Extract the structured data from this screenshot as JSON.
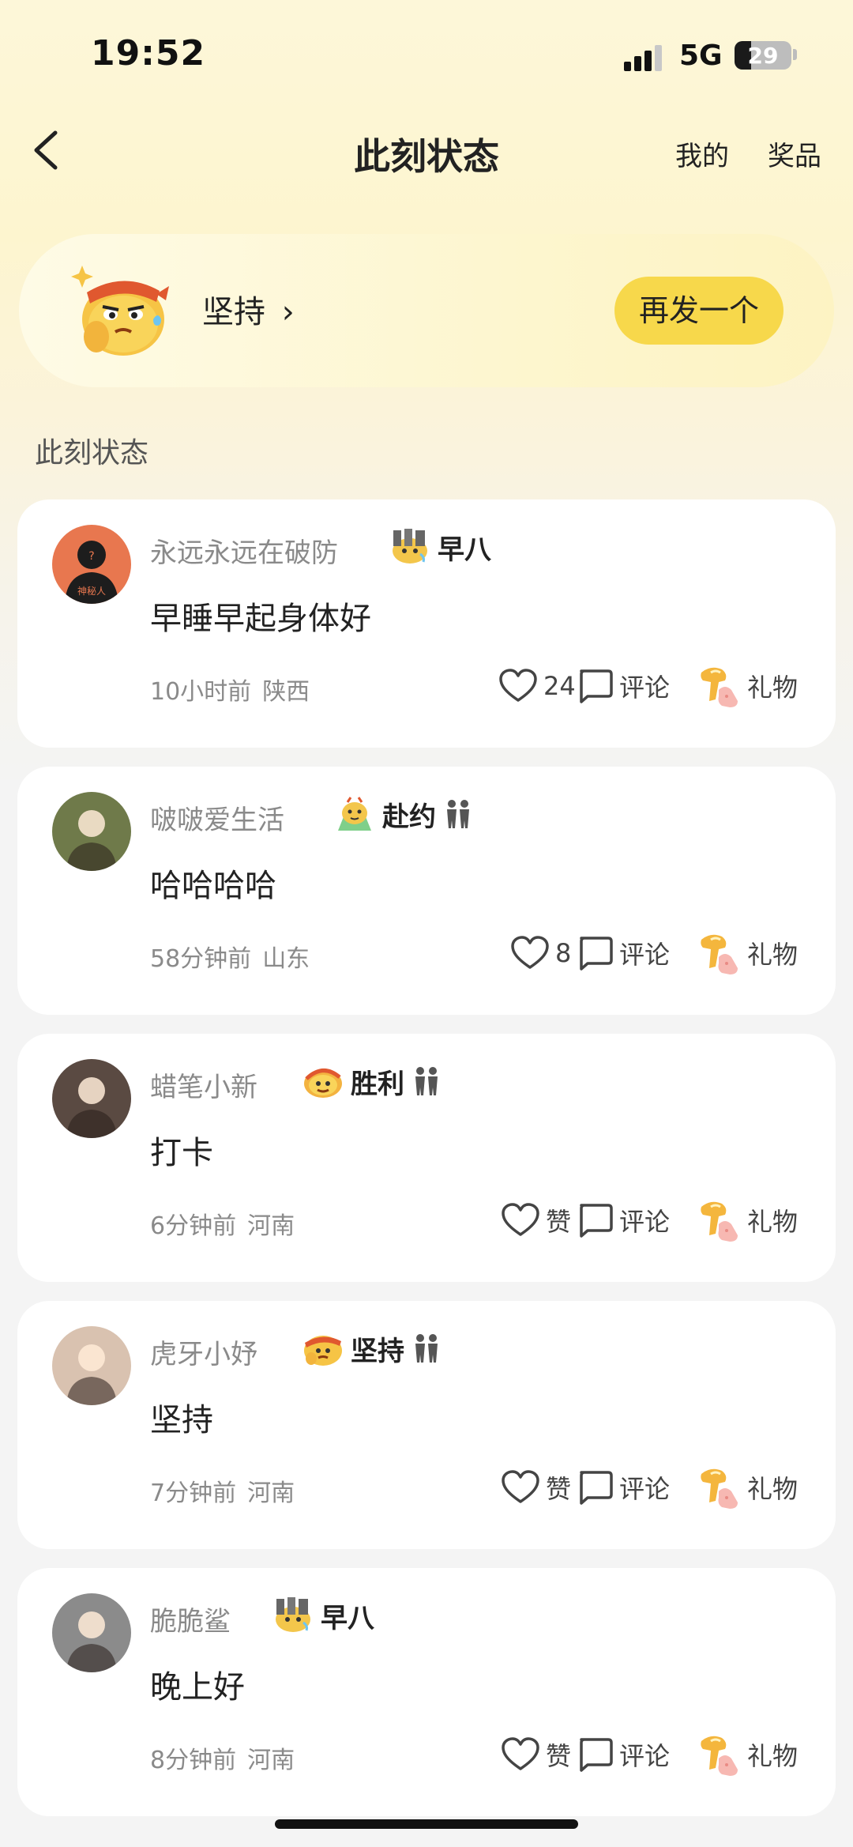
{
  "status": {
    "time": "19:52",
    "network": "5G",
    "battery": "29",
    "battery_level": 0.29
  },
  "nav": {
    "title": "此刻状态",
    "link_mine": "我的",
    "link_prizes": "奖品"
  },
  "hero": {
    "status_label": "坚持",
    "chevron": "›",
    "repost_button": "再发一个"
  },
  "section_title": "此刻状态",
  "avatar_label": "神秘人",
  "actions": {
    "comment": "评论",
    "gift": "礼物"
  },
  "posts": [
    {
      "user": "永远永远在破防",
      "tag": "早八",
      "text": "早睡早起身体好",
      "time": "10小时前",
      "region": "陕西",
      "like": "24",
      "pair": false,
      "avatar_color": "#e8774f"
    },
    {
      "user": "啵啵爱生活",
      "tag": "赴约",
      "text": "哈哈哈哈",
      "time": "58分钟前",
      "region": "山东",
      "like": "8",
      "pair": true,
      "avatar_color": "#6f7a4a"
    },
    {
      "user": "蜡笔小新",
      "tag": "胜利",
      "text": "打卡",
      "time": "6分钟前",
      "region": "河南",
      "like": "赞",
      "pair": true,
      "avatar_color": "#5a4a42"
    },
    {
      "user": "虎牙小妤",
      "tag": "坚持",
      "text": "坚持",
      "time": "7分钟前",
      "region": "河南",
      "like": "赞",
      "pair": true,
      "avatar_color": "#d9c2b0"
    },
    {
      "user": "脆脆鲨",
      "tag": "早八",
      "text": "晚上好",
      "time": "8分钟前",
      "region": "河南",
      "like": "赞",
      "pair": false,
      "avatar_color": "#8b8b8b"
    }
  ]
}
